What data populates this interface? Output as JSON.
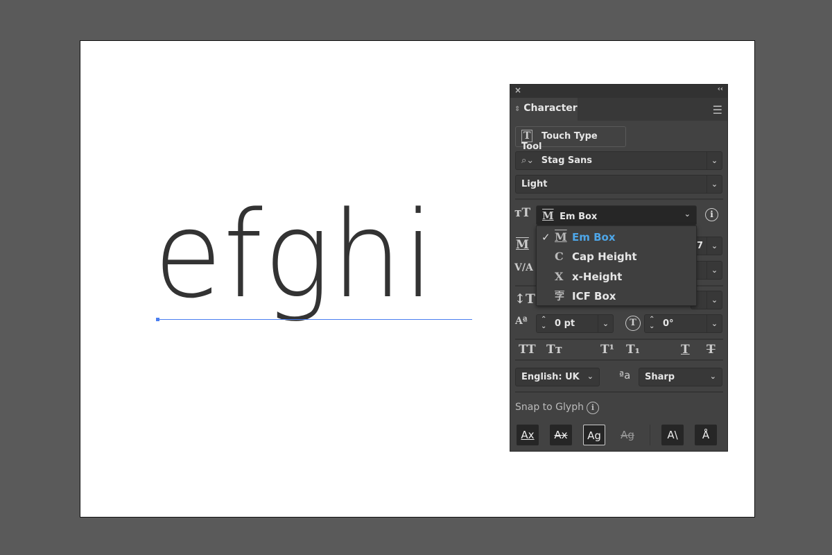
{
  "canvas": {
    "sample_text": "efghi",
    "baseline_color": "#4a7ef0"
  },
  "panel": {
    "close_icon": "×",
    "collapse_icon": "‹‹",
    "tab_label": "Character",
    "touch_type_label": "Touch Type Tool",
    "font_family": "Stag Sans",
    "font_style": "Light",
    "alignment_select": {
      "value": "Em Box",
      "options": [
        {
          "label": "Em Box",
          "selected": true,
          "icon": "M"
        },
        {
          "label": "Cap Height",
          "selected": false,
          "icon": "C"
        },
        {
          "label": "x-Height",
          "selected": false,
          "icon": "X"
        },
        {
          "label": "ICF Box",
          "selected": false,
          "icon": "字"
        }
      ]
    },
    "hidden_value_fragment": "7",
    "baseline_shift": "0 pt",
    "rotation": "0°",
    "language": "English: UK",
    "antialias": "Sharp",
    "snap_label": "Snap to Glyph",
    "accent_color": "#4ea6e8"
  }
}
